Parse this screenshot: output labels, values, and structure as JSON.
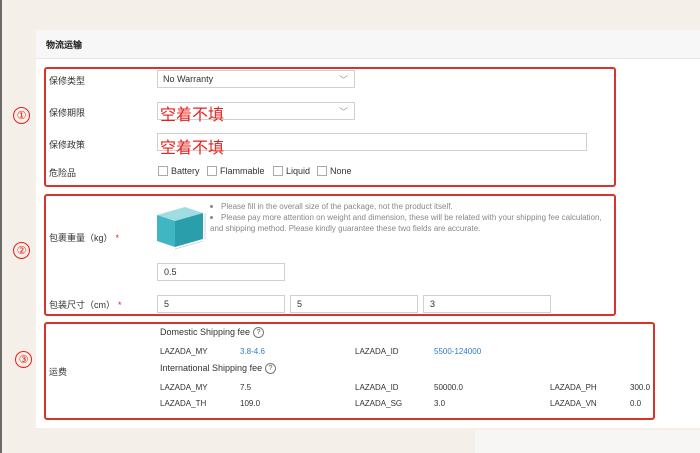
{
  "panel": {
    "title": "物流运输"
  },
  "warranty": {
    "type_label": "保修类型",
    "type_value": "No Warranty",
    "period_label": "保修期限",
    "period_note": "空着不填",
    "policy_label": "保修政策",
    "policy_note": "空着不填",
    "dangerous_label": "危险品",
    "options": [
      "Battery",
      "Flammable",
      "Liquid",
      "None"
    ]
  },
  "package": {
    "tips": [
      "Please fill in the overall size of the package, not the product itself.",
      "Please pay more attention on weight and dimension, these will be related with your shipping fee calculation,",
      "and shipping method. Please kindly guarantee these two fields are accurate."
    ],
    "weight_label": "包裹重量（kg）",
    "weight_value": "0.5",
    "size_label": "包装尺寸（cm）",
    "length": "5",
    "width": "5",
    "height": "3",
    "required_mark": "*"
  },
  "shipping": {
    "label": "运费",
    "domestic_title": "Domestic Shipping fee",
    "international_title": "International Shipping fee",
    "help_glyph": "?",
    "domestic": [
      {
        "name": "LAZADA_MY",
        "value": "3.8-4.6"
      },
      {
        "name": "LAZADA_ID",
        "value": "5500-124000"
      }
    ],
    "international": [
      {
        "name": "LAZADA_MY",
        "value": "7.5"
      },
      {
        "name": "LAZADA_ID",
        "value": "50000.0"
      },
      {
        "name": "LAZADA_PH",
        "value": "300.0"
      },
      {
        "name": "LAZADA_TH",
        "value": "109.0"
      },
      {
        "name": "LAZADA_SG",
        "value": "3.0"
      },
      {
        "name": "LAZADA_VN",
        "value": "0.0"
      }
    ]
  },
  "annotations": {
    "one": "①",
    "two": "②",
    "three": "③"
  },
  "colors": {
    "annotation_red": "#d9342b",
    "link_blue": "#2f7bd0",
    "box_teal": "#3fb6c2"
  }
}
